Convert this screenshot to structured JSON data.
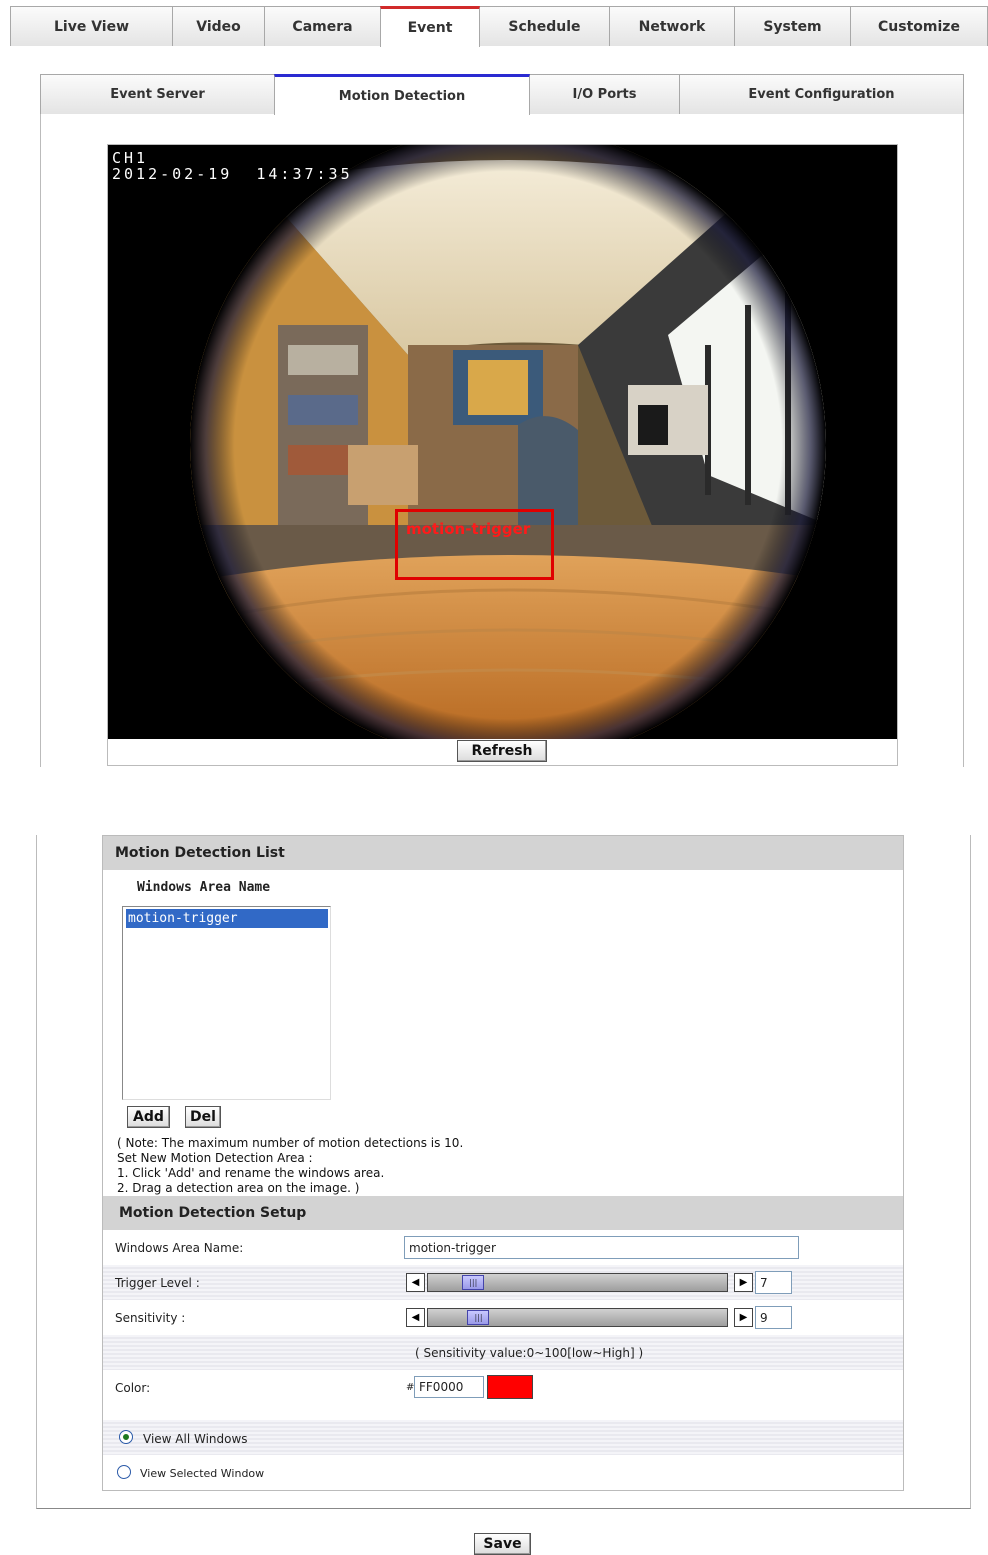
{
  "top_nav": {
    "tabs": [
      {
        "label": "Live View"
      },
      {
        "label": "Video"
      },
      {
        "label": "Camera"
      },
      {
        "label": "Event",
        "active": true
      },
      {
        "label": "Schedule"
      },
      {
        "label": "Network"
      },
      {
        "label": "System"
      },
      {
        "label": "Customize"
      }
    ]
  },
  "sub_nav": {
    "tabs": [
      {
        "label": "Event Server"
      },
      {
        "label": "Motion Detection",
        "active": true
      },
      {
        "label": "I/O Ports"
      },
      {
        "label": "Event Configuration"
      }
    ]
  },
  "camera": {
    "channel": "CH1",
    "timestamp": "2012-02-19  14:37:35",
    "motion_area_label": "motion-trigger",
    "refresh_label": "Refresh"
  },
  "motion_list": {
    "title": "Motion Detection List",
    "column_header": "Windows Area Name",
    "items": [
      "motion-trigger"
    ],
    "add_label": "Add",
    "del_label": "Del",
    "note_lines": [
      "( Note: The maximum number of motion detections is 10.",
      "Set New Motion Detection Area :",
      "1. Click 'Add' and rename the windows area.",
      "2. Drag a detection area on the image. )"
    ]
  },
  "setup": {
    "title": "Motion Detection Setup",
    "area_name_label": "Windows Area Name:",
    "area_name_value": "motion-trigger",
    "trigger_label": "Trigger Level :",
    "trigger_value": "7",
    "trigger_fraction": 0.07,
    "sensitivity_label": "Sensitivity :",
    "sensitivity_value": "9",
    "sensitivity_fraction": 0.09,
    "sensitivity_hint": "( Sensitivity value:0~100[low~High] )",
    "color_label": "Color:",
    "color_prefix": "#",
    "color_value": "FF0000",
    "color_swatch": "#FF0000",
    "view_all_label": "View All Windows",
    "view_all_selected": true,
    "view_selected_label": "View Selected Window",
    "view_selected_selected": false
  },
  "save_label": "Save",
  "colors": {
    "event_tab_accent": "#D12A2A",
    "motion_tab_accent": "#2A2AD1",
    "list_selection": "#3169C6",
    "motion_rect": "#E00000"
  }
}
